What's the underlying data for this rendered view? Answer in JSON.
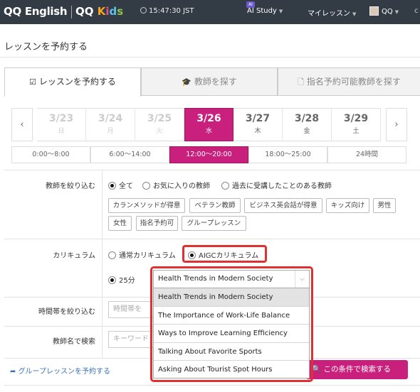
{
  "header": {
    "logo_qq": "QQ English",
    "logo_kids_qq": "QQ",
    "logo_kids": [
      "K",
      "i",
      "d",
      "s"
    ],
    "clock": "15:47:30 JST",
    "ai_badge": "AI",
    "ai_study": "AI Study",
    "my_lessons": "マイレッスン",
    "user": "QQ",
    "user_trunc": "c"
  },
  "page_title": "レッスンを予約する",
  "tabs": [
    {
      "label": "レッスンを予約する",
      "icon": "calendar-check-icon",
      "active": true
    },
    {
      "label": "教師を探す",
      "icon": "graduation-cap-icon",
      "active": false
    },
    {
      "label": "指名予約可能教師を探す",
      "icon": "document-icon",
      "active": false
    }
  ],
  "dates": [
    {
      "date": "3/23",
      "weekday": "日",
      "state": "past"
    },
    {
      "date": "3/24",
      "weekday": "月",
      "state": "past"
    },
    {
      "date": "3/25",
      "weekday": "火",
      "state": "past"
    },
    {
      "date": "3/26",
      "weekday": "水",
      "state": "selected"
    },
    {
      "date": "3/27",
      "weekday": "木",
      "state": "future"
    },
    {
      "date": "3/28",
      "weekday": "金",
      "state": "future"
    },
    {
      "date": "3/29",
      "weekday": "土",
      "state": "future"
    }
  ],
  "date_prev": "‹",
  "date_next": "›",
  "time_slots": [
    {
      "label": "0:00〜8:00",
      "selected": false
    },
    {
      "label": "6:00〜14:00",
      "selected": false
    },
    {
      "label": "12:00〜20:00",
      "selected": true
    },
    {
      "label": "18:00〜25:00",
      "selected": false
    },
    {
      "label": "24時間",
      "selected": false
    }
  ],
  "filter": {
    "label": "教師を絞り込む",
    "options": [
      {
        "label": "全て",
        "checked": true
      },
      {
        "label": "お気に入りの教師",
        "checked": false
      },
      {
        "label": "過去に受講したことのある教師",
        "checked": false
      }
    ],
    "tags_row1": [
      "カランメソッドが得意",
      "ベテラン教師",
      "ビジネス英会話が得意",
      "キッズ向け",
      "男性"
    ],
    "tags_row2": [
      "女性",
      "指名予約可",
      "グループレッスン"
    ]
  },
  "curriculum": {
    "label": "カリキュラム",
    "options": [
      {
        "label": "通常カリキュラム",
        "checked": false
      },
      {
        "label": "AIGCカリキュラム",
        "checked": true
      }
    ],
    "duration": {
      "label": "25分",
      "checked": true
    },
    "select_value": "Health Trends in Modern Society",
    "dropdown_options": [
      {
        "label": "Health Trends in Modern Society",
        "selected": true
      },
      {
        "label": "The Importance of Work-Life Balance",
        "selected": false
      },
      {
        "label": "Ways to Improve Learning Efficiency",
        "selected": false
      },
      {
        "label": "Talking About Favorite Sports",
        "selected": false
      },
      {
        "label": "Asking About Tourist Spot Hours",
        "selected": false
      }
    ]
  },
  "time_filter": {
    "label": "時間帯を絞り込む",
    "placeholder": "時間帯を"
  },
  "name_search": {
    "label": "教師名で検索",
    "placeholder": "キーワード"
  },
  "group_link": "グループレッスンを予約する",
  "search_button": "この条件で検索する",
  "colors": {
    "accent": "#c8207c",
    "highlight": "#e03030",
    "nav_bg": "#333b44"
  }
}
